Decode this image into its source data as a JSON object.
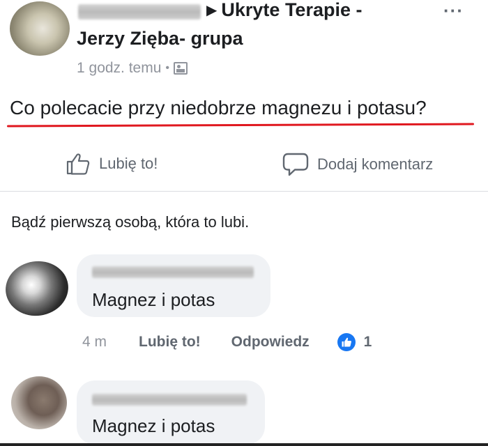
{
  "post": {
    "group_name_line1": "Ukryte Terapie -",
    "group_name_line2": "Jerzy Zięba- grupa",
    "timestamp": "1 godz. temu",
    "separator": "•",
    "more_options": "···",
    "text": "Co polecacie przy niedobrze magnezu i potasu?"
  },
  "actions": {
    "like_label": "Lubię to!",
    "comment_label": "Dodaj komentarz"
  },
  "likes_summary": "Bądź pierwszą osobą, która to lubi.",
  "comments": [
    {
      "text": "Magnez i potas",
      "time": "4 m",
      "like_label": "Lubię to!",
      "reply_label": "Odpowiedz",
      "reaction_count": "1"
    },
    {
      "text": "Magnez i potas"
    }
  ],
  "colors": {
    "accent_underline": "#e0181f",
    "like_badge": "#1877f2",
    "bubble_bg": "#f0f2f5"
  },
  "icons": {
    "like": "thumbs-up-icon",
    "comment": "speech-bubble-icon",
    "audience": "group-audience-icon",
    "reaction": "like-reaction-icon"
  }
}
